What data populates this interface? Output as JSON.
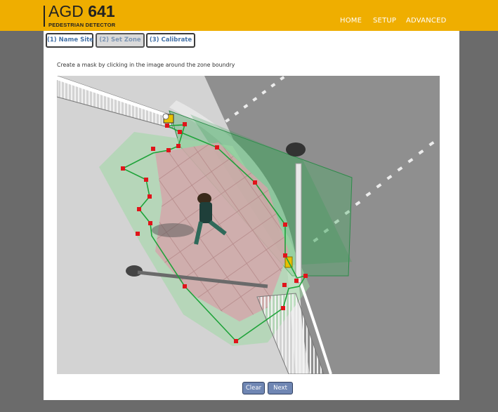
{
  "header": {
    "brand": "AGD",
    "model": "641",
    "subtitle": "PEDESTRIAN DETECTOR",
    "nav": [
      {
        "label": "HOME"
      },
      {
        "label": "SETUP"
      },
      {
        "label": "ADVANCED"
      }
    ]
  },
  "tabs": [
    {
      "label": "(1) Name Site",
      "active": false
    },
    {
      "label": "(2) Set Zone",
      "active": true
    },
    {
      "label": "(3) Calibrate",
      "active": false
    }
  ],
  "instruction": "Create a mask by clicking in the image around the zone boundry",
  "buttons": {
    "clear_label": "Clear",
    "next_label": "Next"
  },
  "colors": {
    "header_bg": "#efae00",
    "page_bg": "#6b6b6b",
    "mask_line": "#1fa33a",
    "mask_point": "#e0141a",
    "button_bg": "#6f86b3"
  }
}
